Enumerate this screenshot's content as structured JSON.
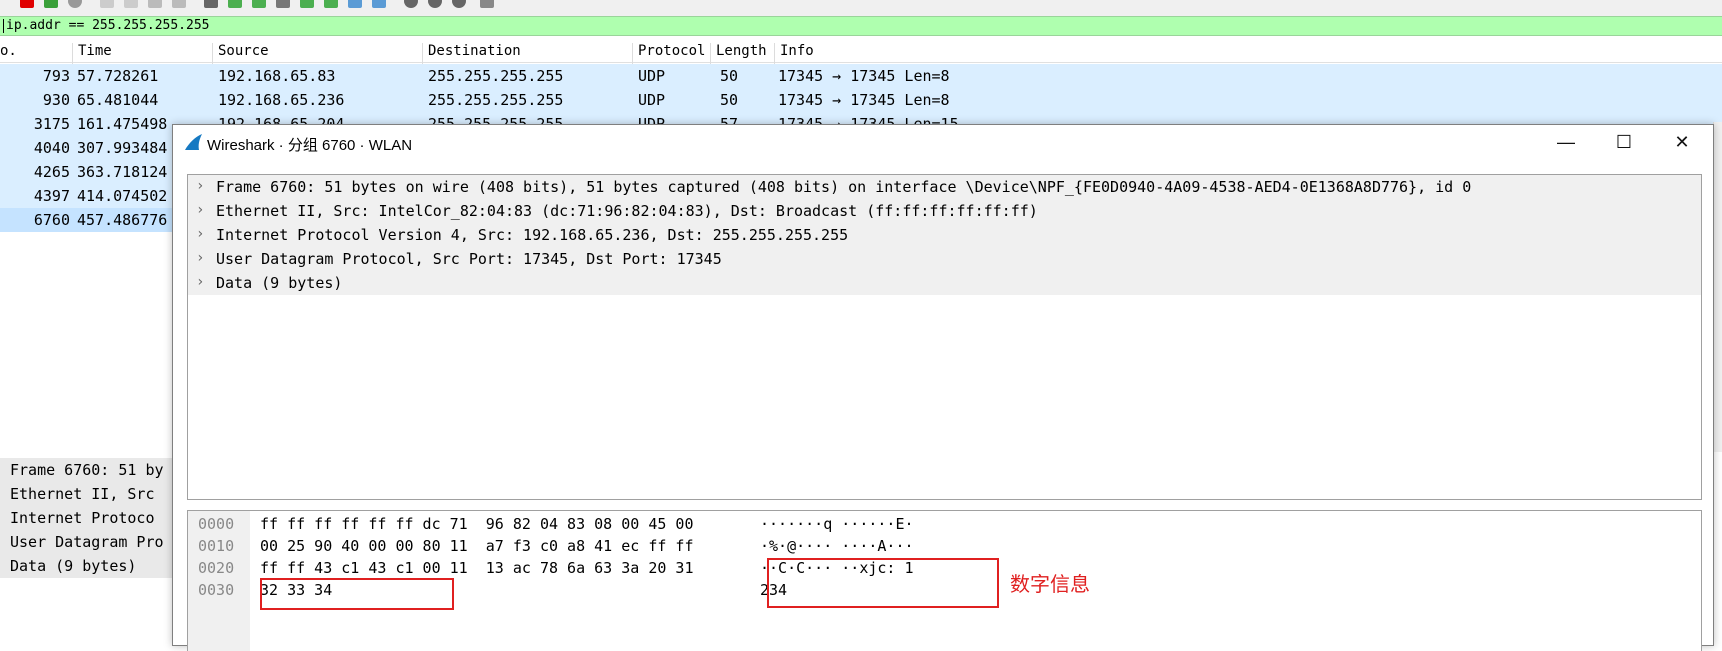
{
  "filter": {
    "value": "ip.addr == 255.255.255.255"
  },
  "packet_list": {
    "headers": [
      "o.",
      "Time",
      "Source",
      "Destination",
      "Protocol",
      "Length",
      "Info"
    ],
    "rows": [
      {
        "no": "793",
        "time": "57.728261",
        "source": "192.168.65.83",
        "destination": "255.255.255.255",
        "protocol": "UDP",
        "length": "50",
        "info": "17345 → 17345 Len=8"
      },
      {
        "no": "930",
        "time": "65.481044",
        "source": "192.168.65.236",
        "destination": "255.255.255.255",
        "protocol": "UDP",
        "length": "50",
        "info": "17345 → 17345 Len=8"
      },
      {
        "no": "3175",
        "time": "161.475498",
        "source": "192.168.65.204",
        "destination": "255.255.255.255",
        "protocol": "UDP",
        "length": "57",
        "info": "17345 → 17345 Len=15"
      },
      {
        "no": "4040",
        "time": "307.993484",
        "source": "",
        "destination": "",
        "protocol": "",
        "length": "",
        "info": ""
      },
      {
        "no": "4265",
        "time": "363.718124",
        "source": "",
        "destination": "",
        "protocol": "",
        "length": "",
        "info": ""
      },
      {
        "no": "4397",
        "time": "414.074502",
        "source": "",
        "destination": "",
        "protocol": "",
        "length": "",
        "info": ""
      },
      {
        "no": "6760",
        "time": "457.486776",
        "source": "",
        "destination": "",
        "protocol": "",
        "length": "",
        "info": ""
      }
    ]
  },
  "bottom_tree": [
    "Frame 6760: 51 by",
    "Ethernet II, Src",
    "Internet Protoco",
    "User Datagram Pro",
    "Data (9 bytes)"
  ],
  "dialog": {
    "title": "Wireshark · 分组 6760 · WLAN",
    "minimize": "—",
    "maximize": "☐",
    "close": "✕",
    "tree": [
      "Frame 6760: 51 bytes on wire (408 bits), 51 bytes captured (408 bits) on interface \\Device\\NPF_{FE0D0940-4A09-4538-AED4-0E1368A8D776}, id 0",
      "Ethernet II, Src: IntelCor_82:04:83 (dc:71:96:82:04:83), Dst: Broadcast (ff:ff:ff:ff:ff:ff)",
      "Internet Protocol Version 4, Src: 192.168.65.236, Dst: 255.255.255.255",
      "User Datagram Protocol, Src Port: 17345, Dst Port: 17345",
      "Data (9 bytes)"
    ],
    "hex": [
      {
        "offset": "0000",
        "bytes": "ff ff ff ff ff ff dc 71  96 82 04 83 08 00 45 00",
        "ascii": "·······q ······E·"
      },
      {
        "offset": "0010",
        "bytes": "00 25 90 40 00 00 80 11  a7 f3 c0 a8 41 ec ff ff",
        "ascii": "·%·@···· ····A···"
      },
      {
        "offset": "0020",
        "bytes": "ff ff 43 c1 43 c1 00 11  13 ac 78 6a 63 3a 20 31",
        "ascii": "··C·C··· ··xjc: 1"
      },
      {
        "offset": "0030",
        "bytes": "32 33 34",
        "ascii": "234"
      }
    ]
  },
  "annotation": "数字信息",
  "colors": {
    "filter_bg": "#afffaf",
    "row_bg": "#daeeff",
    "selected_row_bg": "#c5e3ff",
    "annotation": "#e02020"
  }
}
